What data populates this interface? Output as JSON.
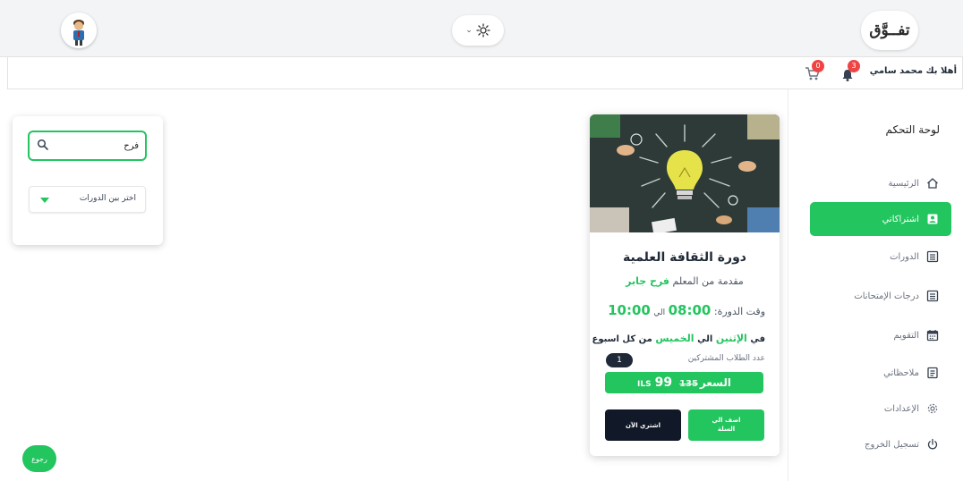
{
  "header": {
    "logo_text": "تفــوَّق",
    "theme_toggle_chevron": "⌄",
    "theme_icon": "sun-icon"
  },
  "subbar": {
    "welcome": "أهلا بك محمد سامي",
    "notifications_count": "3",
    "cart_count": "0"
  },
  "sidebar": {
    "title": "لوحة التحكم",
    "items": [
      {
        "label": "الرئيسية",
        "icon": "home-icon"
      },
      {
        "label": "اشتراكاتي",
        "icon": "user-card-icon",
        "active": true
      },
      {
        "label": "الدورات",
        "icon": "list-icon"
      },
      {
        "label": "درجات الإمتحانات",
        "icon": "list-icon"
      },
      {
        "label": "التقويم",
        "icon": "calendar-icon"
      },
      {
        "label": "ملاحظاتي",
        "icon": "notes-icon"
      },
      {
        "label": "الإعدادات",
        "icon": "gear-icon"
      },
      {
        "label": "تسجيل الخروج",
        "icon": "power-icon"
      }
    ]
  },
  "search": {
    "value": "فرح",
    "select_label": "اختر بين الدورات"
  },
  "course": {
    "title": "دورة الثقافة العلمية",
    "teacher_prefix": "مقدمة من المعلم",
    "teacher_name": "فرح جابر",
    "time_prefix": "وقت الدورة",
    "time_start": "08:00",
    "time_sep": "الي",
    "time_end": "10:00",
    "days_prefix": "في",
    "day_from": "الإثنين",
    "days_sep": "الي",
    "day_to": "الخميس",
    "days_suffix": "من كل اسبوع",
    "students_label": "عدد الطلاب المشتركين",
    "students_count": "1",
    "price_label": "السعر",
    "price_old": "135",
    "price_new": "99",
    "currency": "ILS",
    "add_to_cart_line1": "اضف الي",
    "add_to_cart_line2": "السلة",
    "buy_now": "اشتري الآن"
  },
  "back_button": "رجوع",
  "colors": {
    "accent": "#22c55e",
    "dark": "#111827",
    "badge": "#ef4444"
  }
}
